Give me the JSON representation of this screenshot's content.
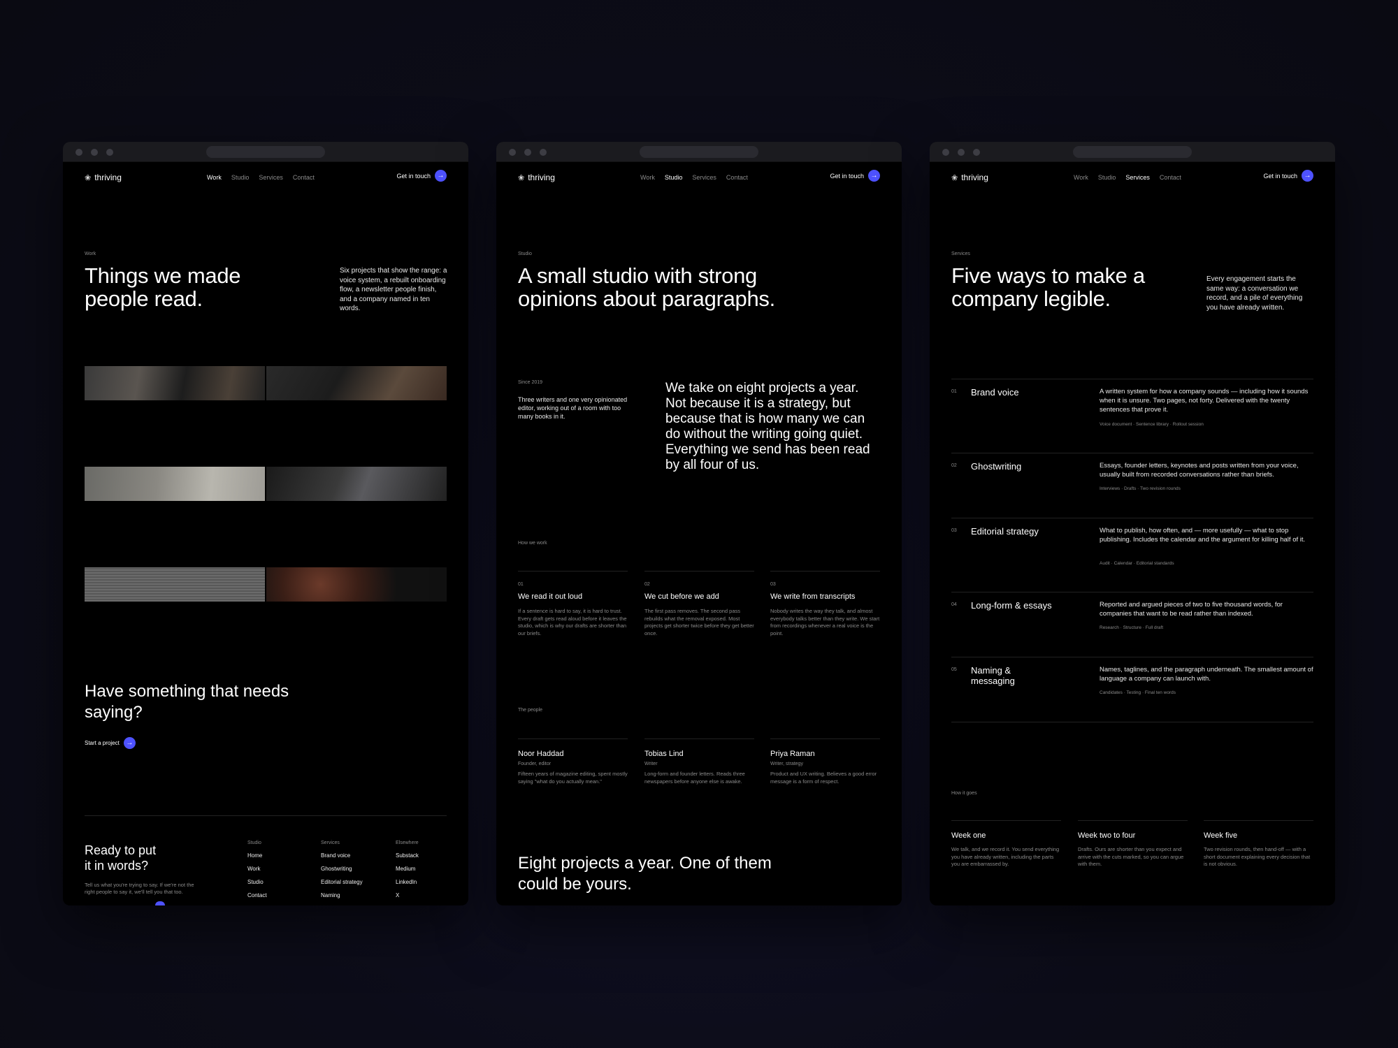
{
  "brand": {
    "logo_text": "thriving",
    "logo_icon": "feather-icon",
    "accent": "#4e52ff"
  },
  "nav": {
    "work": "Work",
    "studio": "Studio",
    "services": "Services",
    "contact": "Contact",
    "cta": "Get in touch",
    "cta_icon": "arrow-right-icon"
  },
  "work": {
    "eyebrow": "Work",
    "title_l1": "Things we made",
    "title_l2": "people read.",
    "intro": "Six projects that show the range: a voice system, a rebuilt onboarding flow, a newsletter people finish, and a company named in ten words.",
    "cta_heading_l1": "Have something that needs",
    "cta_heading_l2": "saying?",
    "cta_button": "Start a project",
    "footer": {
      "title_l1": "Ready to put",
      "title_l2": "it in words?",
      "desc_l1": "Tell us what you're trying to say. If we're not the",
      "desc_l2": "right people to say it, we'll tell you that too.",
      "col1_head": "Studio",
      "col1_links": [
        "Home",
        "Work",
        "Studio",
        "Contact"
      ],
      "col2_head": "Services",
      "col2_links": [
        "Brand voice",
        "Ghostwriting",
        "Editorial strategy",
        "Naming"
      ],
      "col3_head": "Elsewhere",
      "col3_links": [
        "Substack",
        "Medium",
        "LinkedIn",
        "X"
      ]
    }
  },
  "studio": {
    "eyebrow": "Studio",
    "title_l1": "A small studio with strong",
    "title_l2": "opinions about paragraphs.",
    "since": "Since 2019",
    "since_text": "Three writers and one very opinionated editor, working out of a room with too many books in it.",
    "lead": "We take on eight projects a year. Not because it is a strategy, but because that is how many we can do without the writing going quiet. Everything we send has been read by all four of us.",
    "how_label": "How we work",
    "steps": [
      {
        "num": "01",
        "title": "We read it out loud",
        "text": "If a sentence is hard to say, it is hard to trust. Every draft gets read aloud before it leaves the studio, which is why our drafts are shorter than our briefs."
      },
      {
        "num": "02",
        "title": "We cut before we add",
        "text": "The first pass removes. The second pass rebuilds what the removal exposed. Most projects get shorter twice before they get better once."
      },
      {
        "num": "03",
        "title": "We write from transcripts",
        "text": "Nobody writes the way they talk, and almost everybody talks better than they write. We start from recordings whenever a real voice is the point."
      }
    ],
    "people_label": "The people",
    "people": [
      {
        "name": "Noor Haddad",
        "role": "Founder, editor",
        "bio": "Fifteen years of magazine editing, spent mostly saying \"what do you actually mean.\""
      },
      {
        "name": "Tobias Lind",
        "role": "Writer",
        "bio": "Long-form and founder letters. Reads three newspapers before anyone else is awake."
      },
      {
        "name": "Priya Raman",
        "role": "Writer, strategy",
        "bio": "Product and UX writing. Believes a good error message is a form of respect."
      }
    ],
    "closing_l1": "Eight projects a year. One of them",
    "closing_l2": "could be yours."
  },
  "services": {
    "eyebrow": "Services",
    "title_l1": "Five ways to make a",
    "title_l2": "company legible.",
    "intro": "Every engagement starts the same way: a conversation we record, and a pile of everything you have already written.",
    "items": [
      {
        "num": "01",
        "name": "Brand voice",
        "desc": "A written system for how a company sounds — including how it sounds when it is unsure. Two pages, not forty. Delivered with the twenty sentences that prove it.",
        "tags": "Voice document · Sentence library · Rollout session"
      },
      {
        "num": "02",
        "name": "Ghostwriting",
        "desc": "Essays, founder letters, keynotes and posts written from your voice, usually built from recorded conversations rather than briefs.",
        "tags": "Interviews · Drafts · Two revision rounds"
      },
      {
        "num": "03",
        "name": "Editorial strategy",
        "desc": "What to publish, how often, and — more usefully — what to stop publishing. Includes the calendar and the argument for killing half of it.",
        "tags": "Audit · Calendar · Editorial standards"
      },
      {
        "num": "04",
        "name": "Long-form & essays",
        "desc": "Reported and argued pieces of two to five thousand words, for companies that want to be read rather than indexed.",
        "tags": "Research · Structure · Full draft"
      },
      {
        "num": "05",
        "name": "Naming & messaging",
        "desc": "Names, taglines, and the paragraph underneath. The smallest amount of language a company can launch with.",
        "tags": "Candidates · Testing · Final ten words"
      }
    ],
    "process_label": "How it goes",
    "process": [
      {
        "title": "Week one",
        "text": "We talk, and we record it. You send everything you have already written, including the parts you are embarrassed by."
      },
      {
        "title": "Week two to four",
        "text": "Drafts. Ours are shorter than you expect and arrive with the cuts marked, so you can argue with them."
      },
      {
        "title": "Week five",
        "text": "Two revision rounds, then hand-off — with a short document explaining every decision that is not obvious."
      }
    ]
  }
}
